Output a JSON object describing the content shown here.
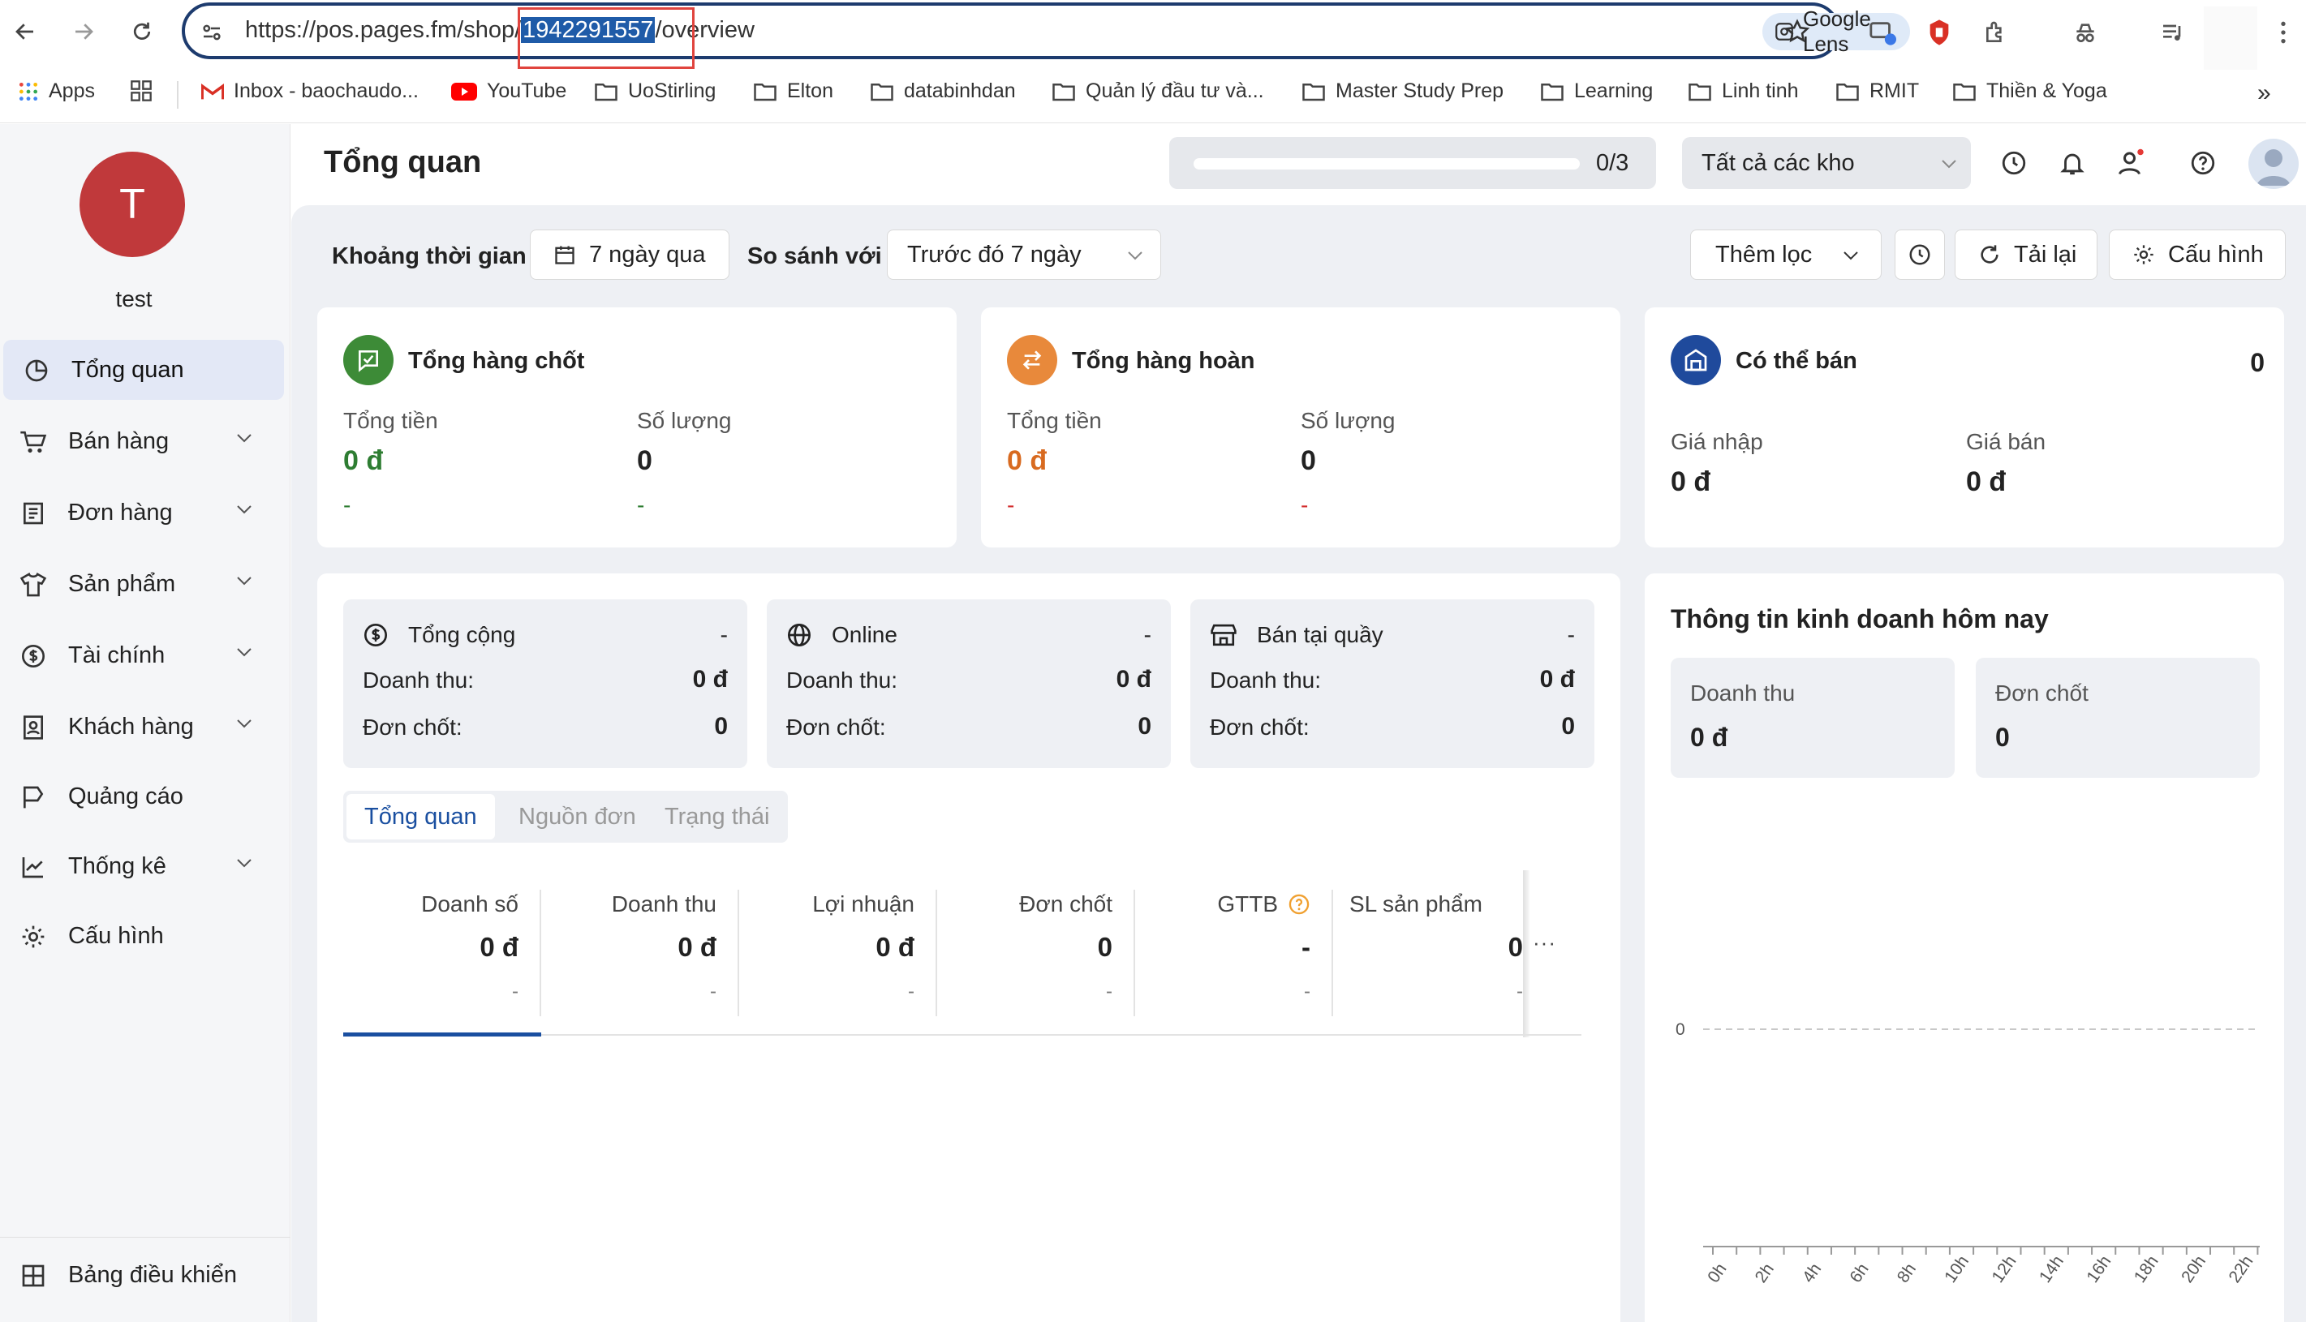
{
  "browser": {
    "url_prefix": "https://pos.pages.fm/shop/",
    "url_selected": "1942291557",
    "url_suffix": "/overview",
    "lens_label": "Google Lens",
    "bookmarks": [
      "Apps",
      "Inbox - baochaudo...",
      "YouTube",
      "UoStirling",
      "Elton",
      "databinhdan",
      "Quản lý đầu tư và...",
      "Master Study Prep",
      "Learning",
      "Linh tinh",
      "RMIT",
      "Thiền & Yoga"
    ],
    "more_bookmarks": "»"
  },
  "sidebar": {
    "avatar_letter": "T",
    "username": "test",
    "items": [
      {
        "label": "Tổng quan",
        "icon": "pie-chart-icon"
      },
      {
        "label": "Bán hàng",
        "icon": "cart-icon"
      },
      {
        "label": "Đơn hàng",
        "icon": "receipt-icon"
      },
      {
        "label": "Sản phẩm",
        "icon": "shirt-icon"
      },
      {
        "label": "Tài chính",
        "icon": "dollar-circle-icon"
      },
      {
        "label": "Khách hàng",
        "icon": "contact-book-icon"
      },
      {
        "label": "Quảng cáo",
        "icon": "flag-icon"
      },
      {
        "label": "Thống kê",
        "icon": "line-chart-icon"
      },
      {
        "label": "Cấu hình",
        "icon": "gear-icon"
      }
    ],
    "footer_label": "Bảng điều khiển"
  },
  "header": {
    "title": "Tổng quan",
    "progress": "0/3",
    "progress_fraction": 0,
    "store_select": "Tất cả các kho"
  },
  "filters": {
    "period_label": "Khoảng thời gian",
    "period_value": "7 ngày qua",
    "compare_label": "So sánh với",
    "compare_value": "Trước đó 7 ngày",
    "add_filter": "Thêm lọc",
    "reload": "Tải lại",
    "config": "Cấu hình"
  },
  "summary": {
    "closed": {
      "title": "Tổng hàng chốt",
      "total_label": "Tổng tiền",
      "total_value": "0 đ",
      "qty_label": "Số lượng",
      "qty_value": "0",
      "total_change": "-",
      "qty_change": "-"
    },
    "returned": {
      "title": "Tổng hàng hoàn",
      "total_label": "Tổng tiền",
      "total_value": "0 đ",
      "qty_label": "Số lượng",
      "qty_value": "0",
      "total_change": "-",
      "qty_change": "-"
    },
    "sellable": {
      "title": "Có thể bán",
      "count": "0",
      "import_label": "Giá nhập",
      "import_value": "0 đ",
      "sale_label": "Giá bán",
      "sale_value": "0 đ"
    }
  },
  "channels": [
    {
      "name": "Tổng cộng",
      "icon": "dollar-circle-icon",
      "delta": "-",
      "rev_label": "Doanh thu:",
      "rev_value": "0 đ",
      "orders_label": "Đơn chốt:",
      "orders_value": "0"
    },
    {
      "name": "Online",
      "icon": "globe-icon",
      "delta": "-",
      "rev_label": "Doanh thu:",
      "rev_value": "0 đ",
      "orders_label": "Đơn chốt:",
      "orders_value": "0"
    },
    {
      "name": "Bán tại quầy",
      "icon": "shop-icon",
      "delta": "-",
      "rev_label": "Doanh thu:",
      "rev_value": "0 đ",
      "orders_label": "Đơn chốt:",
      "orders_value": "0"
    }
  ],
  "tabs": [
    "Tổng quan",
    "Nguồn đơn",
    "Trạng thái"
  ],
  "metrics": [
    {
      "label": "Doanh số",
      "value": "0 đ",
      "change": "-"
    },
    {
      "label": "Doanh thu",
      "value": "0 đ",
      "change": "-"
    },
    {
      "label": "Lợi nhuận",
      "value": "0 đ",
      "change": "-"
    },
    {
      "label": "Đơn chốt",
      "value": "0",
      "change": "-"
    },
    {
      "label": "GTTB",
      "value": "-",
      "change": "-"
    },
    {
      "label": "SL sản phẩm",
      "value": "0",
      "change": "-"
    }
  ],
  "more_symbol": "···",
  "today": {
    "title": "Thông tin kinh doanh hôm nay",
    "revenue_label": "Doanh thu",
    "revenue_value": "0 đ",
    "orders_label": "Đơn chốt",
    "orders_value": "0"
  },
  "chart_data": {
    "type": "line",
    "x": [
      "0h",
      "2h",
      "4h",
      "6h",
      "8h",
      "10h",
      "12h",
      "14h",
      "16h",
      "18h",
      "20h",
      "22h"
    ],
    "y_ticks": [
      "0"
    ],
    "series": [
      {
        "values": [
          0,
          0,
          0,
          0,
          0,
          0,
          0,
          0,
          0,
          0,
          0,
          0
        ]
      }
    ],
    "grid": true
  },
  "colors": {
    "accent": "#1a4fa0",
    "green": "#2e7d32",
    "orange": "#e8893b",
    "navy": "#1f4a9c",
    "avatar": "#c0393b"
  }
}
